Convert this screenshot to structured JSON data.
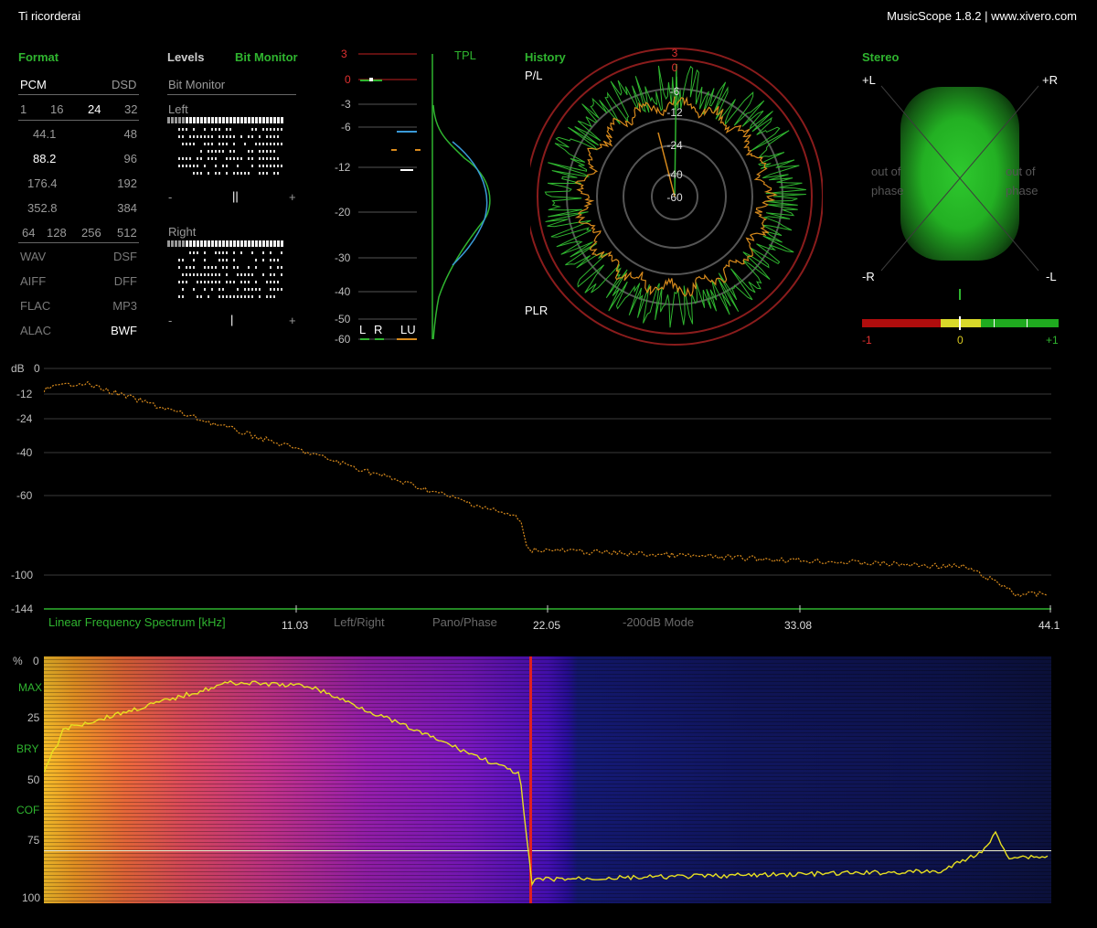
{
  "window": {
    "title": "Ti ricorderai",
    "app": "MusicScope 1.8.2 | www.xivero.com"
  },
  "format": {
    "heading": "Format",
    "pcm": "PCM",
    "dsd": "DSD",
    "bit_depths": [
      "1",
      "16",
      "24",
      "32"
    ],
    "bit_depth_selected": "24",
    "rates_left": [
      "44.1",
      "88.2",
      "176.4",
      "352.8"
    ],
    "rates_right": [
      "48",
      "96",
      "192",
      "384"
    ],
    "rate_selected": "88.2",
    "dsd_rates": [
      "64",
      "128",
      "256",
      "512"
    ],
    "files_left": [
      "WAV",
      "AIFF",
      "FLAC",
      "ALAC"
    ],
    "files_right": [
      "DSF",
      "DFF",
      "MP3",
      "BWF"
    ],
    "file_selected": "BWF"
  },
  "levels_tabs": {
    "levels": "Levels",
    "bit_monitor": "Bit Monitor"
  },
  "bit_monitor": {
    "title": "Bit Monitor",
    "left_label": "Left",
    "right_label": "Right",
    "minus": "-",
    "plus": "+"
  },
  "tpl": {
    "label": "TPL",
    "scale": [
      "3",
      "0",
      "-3",
      "-6",
      "-12",
      "-20",
      "-30",
      "-40",
      "-50",
      "-60"
    ],
    "channels": [
      "L",
      "R",
      "LU"
    ]
  },
  "history": {
    "heading": "History",
    "pl": "P/L",
    "plr": "PLR",
    "rings": [
      "3",
      "0",
      "-6",
      "-12",
      "-24",
      "-40",
      "-60"
    ]
  },
  "stereo": {
    "heading": "Stereo",
    "plus_l": "+L",
    "plus_r": "+R",
    "minus_r": "-R",
    "minus_l": "-L",
    "out_of_phase": "out of phase",
    "corr_labels": [
      "-1",
      "0",
      "+1"
    ]
  },
  "spectrum": {
    "unit": "dB",
    "y_ticks": [
      "0",
      "-12",
      "-24",
      "-40",
      "-60",
      "-100",
      "-144"
    ],
    "x_ticks": [
      "11.03",
      "22.05",
      "33.08",
      "44.1"
    ],
    "label": "Linear Frequency Spectrum [kHz]",
    "modes": [
      "Left/Right",
      "Pano/Phase",
      "-200dB Mode"
    ]
  },
  "spectrogram": {
    "pct": "%",
    "y_ticks": [
      "0",
      "25",
      "50",
      "75",
      "100"
    ],
    "markers": [
      "MAX",
      "BRY",
      "COF"
    ]
  },
  "colors": {
    "accent_green": "#2fb42f",
    "spectrum_orange": "#d88a1c",
    "cutoff_red": "#e02020"
  }
}
